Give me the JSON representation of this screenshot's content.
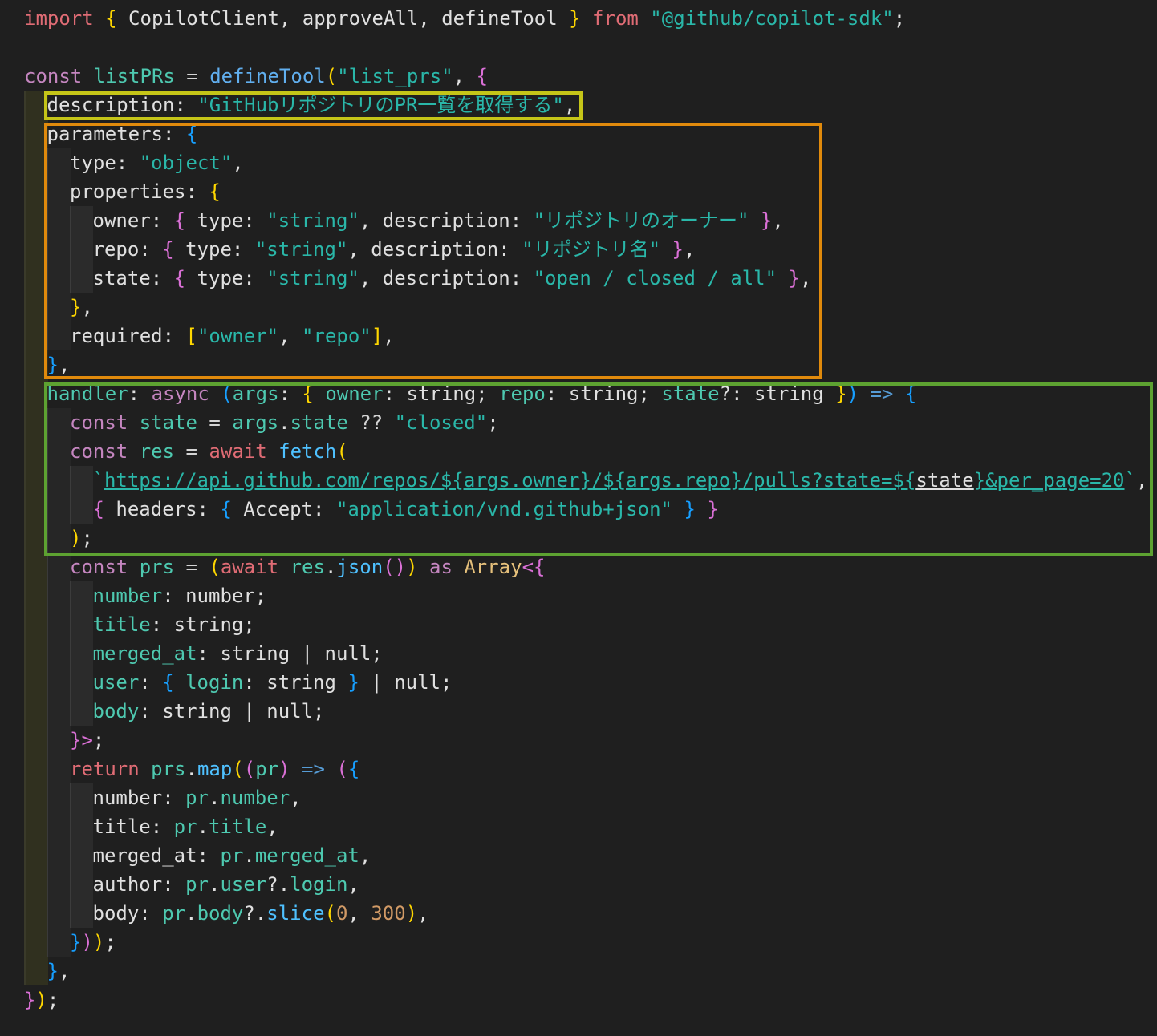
{
  "editor": {
    "language": "typescript",
    "lines": [
      [
        [
          "import",
          "red"
        ],
        [
          " ",
          "txt"
        ],
        [
          "{",
          "by"
        ],
        [
          " CopilotClient, approveAll, defineTool ",
          "txt"
        ],
        [
          "}",
          "by"
        ],
        [
          " ",
          "txt"
        ],
        [
          "from",
          "red"
        ],
        [
          " ",
          "txt"
        ],
        [
          "\"@github/copilot-sdk\"",
          "str"
        ],
        [
          ";",
          "txt"
        ]
      ],
      [],
      [
        [
          "const",
          "kw"
        ],
        [
          " ",
          "txt"
        ],
        [
          "listPRs",
          "var"
        ],
        [
          " = ",
          "op"
        ],
        [
          "defineTool",
          "fn2"
        ],
        [
          "(",
          "by"
        ],
        [
          "\"list_prs\"",
          "str"
        ],
        [
          ", ",
          "txt"
        ],
        [
          "{",
          "bp"
        ]
      ],
      [
        [
          "description",
          "txt"
        ],
        [
          ": ",
          "txt"
        ],
        [
          "\"GitHubリポジトリのPR一覧を取得する\"",
          "str"
        ],
        [
          ",",
          "txt"
        ]
      ],
      [
        [
          "parameters",
          "txt"
        ],
        [
          ": ",
          "txt"
        ],
        [
          "{",
          "bb"
        ]
      ],
      [
        [
          "type",
          "txt"
        ],
        [
          ": ",
          "txt"
        ],
        [
          "\"object\"",
          "str"
        ],
        [
          ",",
          "txt"
        ]
      ],
      [
        [
          "properties",
          "txt"
        ],
        [
          ": ",
          "txt"
        ],
        [
          "{",
          "by"
        ]
      ],
      [
        [
          "owner",
          "txt"
        ],
        [
          ": ",
          "txt"
        ],
        [
          "{",
          "bp"
        ],
        [
          " type: ",
          "txt"
        ],
        [
          "\"string\"",
          "str"
        ],
        [
          ", description: ",
          "txt"
        ],
        [
          "\"リポジトリのオーナー\"",
          "str"
        ],
        [
          " ",
          "txt"
        ],
        [
          "}",
          "bp"
        ],
        [
          ",",
          "txt"
        ]
      ],
      [
        [
          "repo",
          "txt"
        ],
        [
          ": ",
          "txt"
        ],
        [
          "{",
          "bp"
        ],
        [
          " type: ",
          "txt"
        ],
        [
          "\"string\"",
          "str"
        ],
        [
          ", description: ",
          "txt"
        ],
        [
          "\"リポジトリ名\"",
          "str"
        ],
        [
          " ",
          "txt"
        ],
        [
          "}",
          "bp"
        ],
        [
          ",",
          "txt"
        ]
      ],
      [
        [
          "state",
          "txt"
        ],
        [
          ": ",
          "txt"
        ],
        [
          "{",
          "bp"
        ],
        [
          " type: ",
          "txt"
        ],
        [
          "\"string\"",
          "str"
        ],
        [
          ", description: ",
          "txt"
        ],
        [
          "\"open / closed / all\"",
          "str"
        ],
        [
          " ",
          "txt"
        ],
        [
          "}",
          "bp"
        ],
        [
          ",",
          "txt"
        ]
      ],
      [
        [
          "}",
          "by"
        ],
        [
          ",",
          "txt"
        ]
      ],
      [
        [
          "required",
          "txt"
        ],
        [
          ": ",
          "txt"
        ],
        [
          "[",
          "by"
        ],
        [
          "\"owner\"",
          "str"
        ],
        [
          ", ",
          "txt"
        ],
        [
          "\"repo\"",
          "str"
        ],
        [
          "]",
          "by"
        ],
        [
          ",",
          "txt"
        ]
      ],
      [
        [
          "}",
          "bb"
        ],
        [
          ",",
          "txt"
        ]
      ],
      [
        [
          "handler",
          "var"
        ],
        [
          ": ",
          "txt"
        ],
        [
          "async",
          "kw"
        ],
        [
          " ",
          "txt"
        ],
        [
          "(",
          "bb"
        ],
        [
          "args",
          "var"
        ],
        [
          ": ",
          "txt"
        ],
        [
          "{",
          "by"
        ],
        [
          " ",
          "txt"
        ],
        [
          "owner",
          "var"
        ],
        [
          ": string; ",
          "txt"
        ],
        [
          "repo",
          "var"
        ],
        [
          ": string; ",
          "txt"
        ],
        [
          "state",
          "var"
        ],
        [
          "?: string ",
          "txt"
        ],
        [
          "}",
          "by"
        ],
        [
          ")",
          "bb"
        ],
        [
          " ",
          "txt"
        ],
        [
          "=>",
          "kwb"
        ],
        [
          " ",
          "txt"
        ],
        [
          "{",
          "bb"
        ]
      ],
      [
        [
          "const",
          "kw"
        ],
        [
          " ",
          "txt"
        ],
        [
          "state",
          "var"
        ],
        [
          " = ",
          "op"
        ],
        [
          "args",
          "var"
        ],
        [
          ".",
          "txt"
        ],
        [
          "state",
          "var"
        ],
        [
          " ?? ",
          "op"
        ],
        [
          "\"closed\"",
          "str"
        ],
        [
          ";",
          "txt"
        ]
      ],
      [
        [
          "const",
          "kw"
        ],
        [
          " ",
          "txt"
        ],
        [
          "res",
          "var"
        ],
        [
          " = ",
          "op"
        ],
        [
          "await",
          "red"
        ],
        [
          " ",
          "txt"
        ],
        [
          "fetch",
          "fn"
        ],
        [
          "(",
          "by"
        ]
      ],
      [
        [
          "`",
          "str"
        ],
        [
          "https://api.github.com/repos/${args.owner}/${args.repo}/pulls?state=${",
          "url"
        ],
        [
          "state",
          "urlv"
        ],
        [
          "}&per_page=20",
          "url"
        ],
        [
          "`",
          "str"
        ],
        [
          ",",
          "txt"
        ]
      ],
      [
        [
          "{",
          "bp"
        ],
        [
          " headers: ",
          "txt"
        ],
        [
          "{",
          "bb"
        ],
        [
          " Accept: ",
          "txt"
        ],
        [
          "\"application/vnd.github+json\"",
          "str"
        ],
        [
          " ",
          "txt"
        ],
        [
          "}",
          "bb"
        ],
        [
          " ",
          "txt"
        ],
        [
          "}",
          "bp"
        ]
      ],
      [
        [
          ")",
          "by"
        ],
        [
          ";",
          "txt"
        ]
      ],
      [
        [
          "const",
          "kw"
        ],
        [
          " ",
          "txt"
        ],
        [
          "prs",
          "var"
        ],
        [
          " = ",
          "op"
        ],
        [
          "(",
          "by"
        ],
        [
          "await",
          "red"
        ],
        [
          " ",
          "txt"
        ],
        [
          "res",
          "var"
        ],
        [
          ".",
          "txt"
        ],
        [
          "json",
          "fn"
        ],
        [
          "()",
          "bp"
        ],
        [
          ")",
          "by"
        ],
        [
          " ",
          "txt"
        ],
        [
          "as",
          "kw"
        ],
        [
          " ",
          "txt"
        ],
        [
          "Array",
          "type"
        ],
        [
          "<{",
          "bp"
        ]
      ],
      [
        [
          "number",
          "var"
        ],
        [
          ": number;",
          "txt"
        ]
      ],
      [
        [
          "title",
          "var"
        ],
        [
          ": string;",
          "txt"
        ]
      ],
      [
        [
          "merged_at",
          "var"
        ],
        [
          ": string | null;",
          "txt"
        ]
      ],
      [
        [
          "user",
          "var"
        ],
        [
          ": ",
          "txt"
        ],
        [
          "{",
          "bb"
        ],
        [
          " ",
          "txt"
        ],
        [
          "login",
          "var"
        ],
        [
          ": string ",
          "txt"
        ],
        [
          "}",
          "bb"
        ],
        [
          " | null;",
          "txt"
        ]
      ],
      [
        [
          "body",
          "var"
        ],
        [
          ": string | null;",
          "txt"
        ]
      ],
      [
        [
          "}>",
          "bp"
        ],
        [
          ";",
          "txt"
        ]
      ],
      [
        [
          "return",
          "red"
        ],
        [
          " ",
          "txt"
        ],
        [
          "prs",
          "var"
        ],
        [
          ".",
          "txt"
        ],
        [
          "map",
          "fn"
        ],
        [
          "(",
          "by"
        ],
        [
          "(",
          "bp"
        ],
        [
          "pr",
          "var"
        ],
        [
          ")",
          "bp"
        ],
        [
          " ",
          "txt"
        ],
        [
          "=>",
          "kwb"
        ],
        [
          " ",
          "txt"
        ],
        [
          "(",
          "bp"
        ],
        [
          "{",
          "bb"
        ]
      ],
      [
        [
          "number: ",
          "txt"
        ],
        [
          "pr",
          "var"
        ],
        [
          ".",
          "txt"
        ],
        [
          "number",
          "var"
        ],
        [
          ",",
          "txt"
        ]
      ],
      [
        [
          "title: ",
          "txt"
        ],
        [
          "pr",
          "var"
        ],
        [
          ".",
          "txt"
        ],
        [
          "title",
          "var"
        ],
        [
          ",",
          "txt"
        ]
      ],
      [
        [
          "merged_at: ",
          "txt"
        ],
        [
          "pr",
          "var"
        ],
        [
          ".",
          "txt"
        ],
        [
          "merged_at",
          "var"
        ],
        [
          ",",
          "txt"
        ]
      ],
      [
        [
          "author: ",
          "txt"
        ],
        [
          "pr",
          "var"
        ],
        [
          ".",
          "txt"
        ],
        [
          "user",
          "var"
        ],
        [
          "?.",
          "txt"
        ],
        [
          "login",
          "var"
        ],
        [
          ",",
          "txt"
        ]
      ],
      [
        [
          "body: ",
          "txt"
        ],
        [
          "pr",
          "var"
        ],
        [
          ".",
          "txt"
        ],
        [
          "body",
          "var"
        ],
        [
          "?.",
          "txt"
        ],
        [
          "slice",
          "fn"
        ],
        [
          "(",
          "by"
        ],
        [
          "0",
          "num"
        ],
        [
          ", ",
          "txt"
        ],
        [
          "300",
          "num"
        ],
        [
          ")",
          "by"
        ],
        [
          ",",
          "txt"
        ]
      ],
      [
        [
          "}",
          "bb"
        ],
        [
          ")",
          "bp"
        ],
        [
          ")",
          "by"
        ],
        [
          ";",
          "txt"
        ]
      ],
      [
        [
          "}",
          "bb"
        ],
        [
          ",",
          "txt"
        ]
      ],
      [
        [
          "}",
          "bp"
        ],
        [
          ")",
          "by"
        ],
        [
          ";",
          "txt"
        ]
      ]
    ],
    "indents": [
      0,
      0,
      0,
      1,
      1,
      2,
      2,
      3,
      3,
      3,
      2,
      2,
      1,
      1,
      2,
      2,
      3,
      3,
      2,
      2,
      3,
      3,
      3,
      3,
      3,
      2,
      2,
      3,
      3,
      3,
      3,
      3,
      2,
      1,
      0
    ],
    "highlight_colors": {
      "description_box": "#c5c518",
      "parameters_box": "#e08a0c",
      "handler_box": "#5da231"
    }
  }
}
